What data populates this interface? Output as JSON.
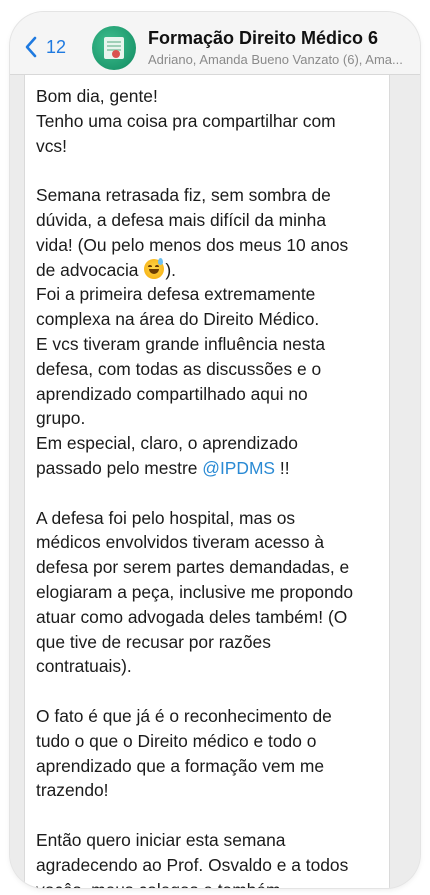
{
  "header": {
    "back_count": "12",
    "title": "Formação Direito Médico 6",
    "subtitle": "Adriano, Amanda Bueno Vanzato (6), Ama..."
  },
  "message": {
    "lines": [
      "Bom dia, gente!",
      "Tenho uma coisa pra compartilhar com",
      "vcs!",
      "",
      "Semana retrasada fiz, sem sombra de",
      "dúvida, a defesa mais difícil da minha",
      "vida! (Ou pelo menos dos meus 10 anos",
      "de advocacia",
      "Foi a primeira defesa extremamente",
      "complexa na área do Direito Médico.",
      "E vcs tiveram grande influência nesta",
      "defesa, com todas as discussões e o",
      "aprendizado compartilhado aqui no",
      "grupo.",
      "Em especial, claro, o aprendizado",
      "passado pelo mestre",
      "",
      "A defesa foi pelo hospital, mas os",
      "médicos envolvidos tiveram acesso à",
      "defesa por serem partes demandadas, e",
      "elogiaram a peça, inclusive me propondo",
      "atuar como advogada deles também! (O",
      "que tive de recusar por razões",
      "contratuais).",
      "",
      "O fato é que já é o reconhecimento de",
      "tudo o que o Direito médico e todo o",
      "aprendizado que a formação vem me",
      "trazendo!",
      "",
      "Então quero iniciar esta semana",
      "agradecendo ao Prof. Osvaldo e a todos",
      "vocês, meus colegas e também"
    ],
    "line8_suffix": ").",
    "mention": "@IPDMS",
    "mention_suffix": " !!",
    "emoji": "sweat-smile-emoji"
  },
  "colors": {
    "accent": "#1f7ae0",
    "mention": "#2a8ad4",
    "avatar": "#1e9a6e"
  }
}
